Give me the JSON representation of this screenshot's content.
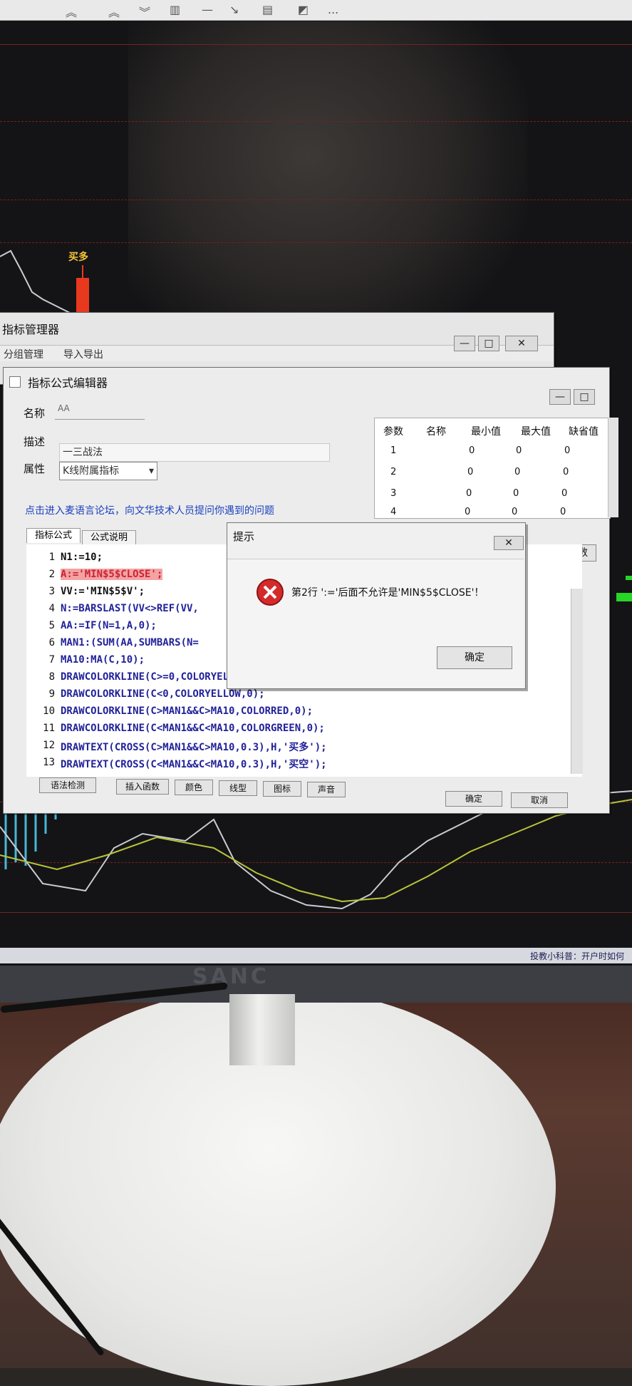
{
  "toolbar": {
    "icons": [
      "double-up-arrow-icon",
      "double-down-arrow-icon",
      "ruler-icon",
      "line-icon",
      "diagonal-arrow-icon",
      "text-box-icon",
      "eraser-icon",
      "more-icon"
    ],
    "more_label": "..."
  },
  "chart": {
    "signal_label": "买多",
    "colors": {
      "up": "#e8391f",
      "label": "#f2c33a",
      "ma_line": "#b8c43a",
      "price_line": "#c9ccd3",
      "grid": "#7a2020"
    }
  },
  "manager_window": {
    "title": "指标管理器",
    "menu": [
      "分组管理",
      "导入导出"
    ],
    "controls": {
      "minimize": "—",
      "maximize": "□",
      "close": "✕"
    }
  },
  "editor_window": {
    "title": "指标公式编辑器",
    "fields": {
      "name_label": "名称",
      "name_value": "AA",
      "desc_label": "描述",
      "desc_value": "一三战法",
      "attr_label": "属性",
      "attr_value": "K线附属指标"
    },
    "param_table": {
      "headers": [
        "参数",
        "名称",
        "最小值",
        "最大值",
        "缺省值"
      ],
      "rows": [
        [
          "1",
          "",
          "0",
          "0",
          "0"
        ],
        [
          "2",
          "",
          "0",
          "0",
          "0"
        ],
        [
          "3",
          "",
          "0",
          "0",
          "0"
        ],
        [
          "4",
          "",
          "0",
          "0",
          "0"
        ]
      ]
    },
    "forum_link": "点击进入麦语言论坛，向文华技术人员提问你遇到的问题",
    "system_params_button": "系统参数",
    "tabs": [
      "指标公式",
      "公式说明"
    ],
    "code_lines": [
      {
        "no": "1",
        "text": "N1:=10;"
      },
      {
        "no": "2",
        "text": "A:='MIN$5$CLOSE';"
      },
      {
        "no": "3",
        "text": "VV:='MIN$5$V';"
      },
      {
        "no": "4",
        "text": "N:=BARSLAST(VV<>REF(VV,"
      },
      {
        "no": "5",
        "text": "AA:=IF(N=1,A,0);"
      },
      {
        "no": "6",
        "text": "MAN1:(SUM(AA,SUMBARS(N="
      },
      {
        "no": "7",
        "text": "MA10:MA(C,10);"
      },
      {
        "no": "8",
        "text": "DRAWCOLORKLINE(C>=0,COLORYELLOW,1);"
      },
      {
        "no": "9",
        "text": "DRAWCOLORKLINE(C<0,COLORYELLOW,0);"
      },
      {
        "no": "10",
        "text": "DRAWCOLORKLINE(C>MAN1&&C>MA10,COLORRED,0);"
      },
      {
        "no": "11",
        "text": "DRAWCOLORKLINE(C<MAN1&&C<MA10,COLORGREEN,0);"
      },
      {
        "no": "12",
        "text": "DRAWTEXT(CROSS(C>MAN1&&C>MA10,0.3),H,'买多');"
      },
      {
        "no": "13",
        "text": "DRAWTEXT(CROSS(C<MAN1&&C<MA10,0.3),H,'买空');"
      }
    ],
    "bottom_buttons": [
      "语法检测",
      "插入函数",
      "颜色",
      "线型",
      "图标",
      "声音"
    ],
    "ok_label": "确定",
    "cancel_label": "取消"
  },
  "alert": {
    "title": "提示",
    "close": "✕",
    "message": "第2行 ':='后面不允许是'MIN$5$CLOSE'！",
    "ok_label": "确定",
    "icon": "error-icon"
  },
  "status_bar": {
    "text": "投教小科普：开户时如何"
  },
  "monitor": {
    "brand": "SANC"
  }
}
